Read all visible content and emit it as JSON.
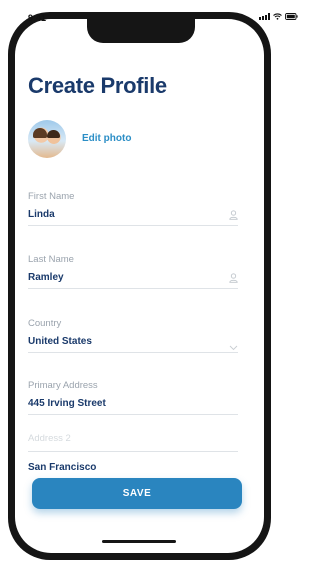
{
  "status_bar": {
    "time": "9:41"
  },
  "header": {
    "title": "Create Profile"
  },
  "profile": {
    "edit_photo_label": "Edit photo"
  },
  "fields": {
    "first_name": {
      "label": "First Name",
      "value": "Linda",
      "icon": "person-icon"
    },
    "last_name": {
      "label": "Last Name",
      "value": "Ramley",
      "icon": "person-icon"
    },
    "country": {
      "label": "Country",
      "value": "United States",
      "icon": "chevron-down-icon"
    },
    "primary_address": {
      "label": "Primary Address",
      "value": "445 Irving Street"
    },
    "address_2": {
      "placeholder": "Address 2"
    },
    "city": {
      "value": "San Francisco"
    }
  },
  "actions": {
    "save_label": "SAVE"
  },
  "colors": {
    "accent": "#2a85bf",
    "title": "#1a3a6b",
    "label": "#9aa3ad",
    "frame": "#151515"
  }
}
